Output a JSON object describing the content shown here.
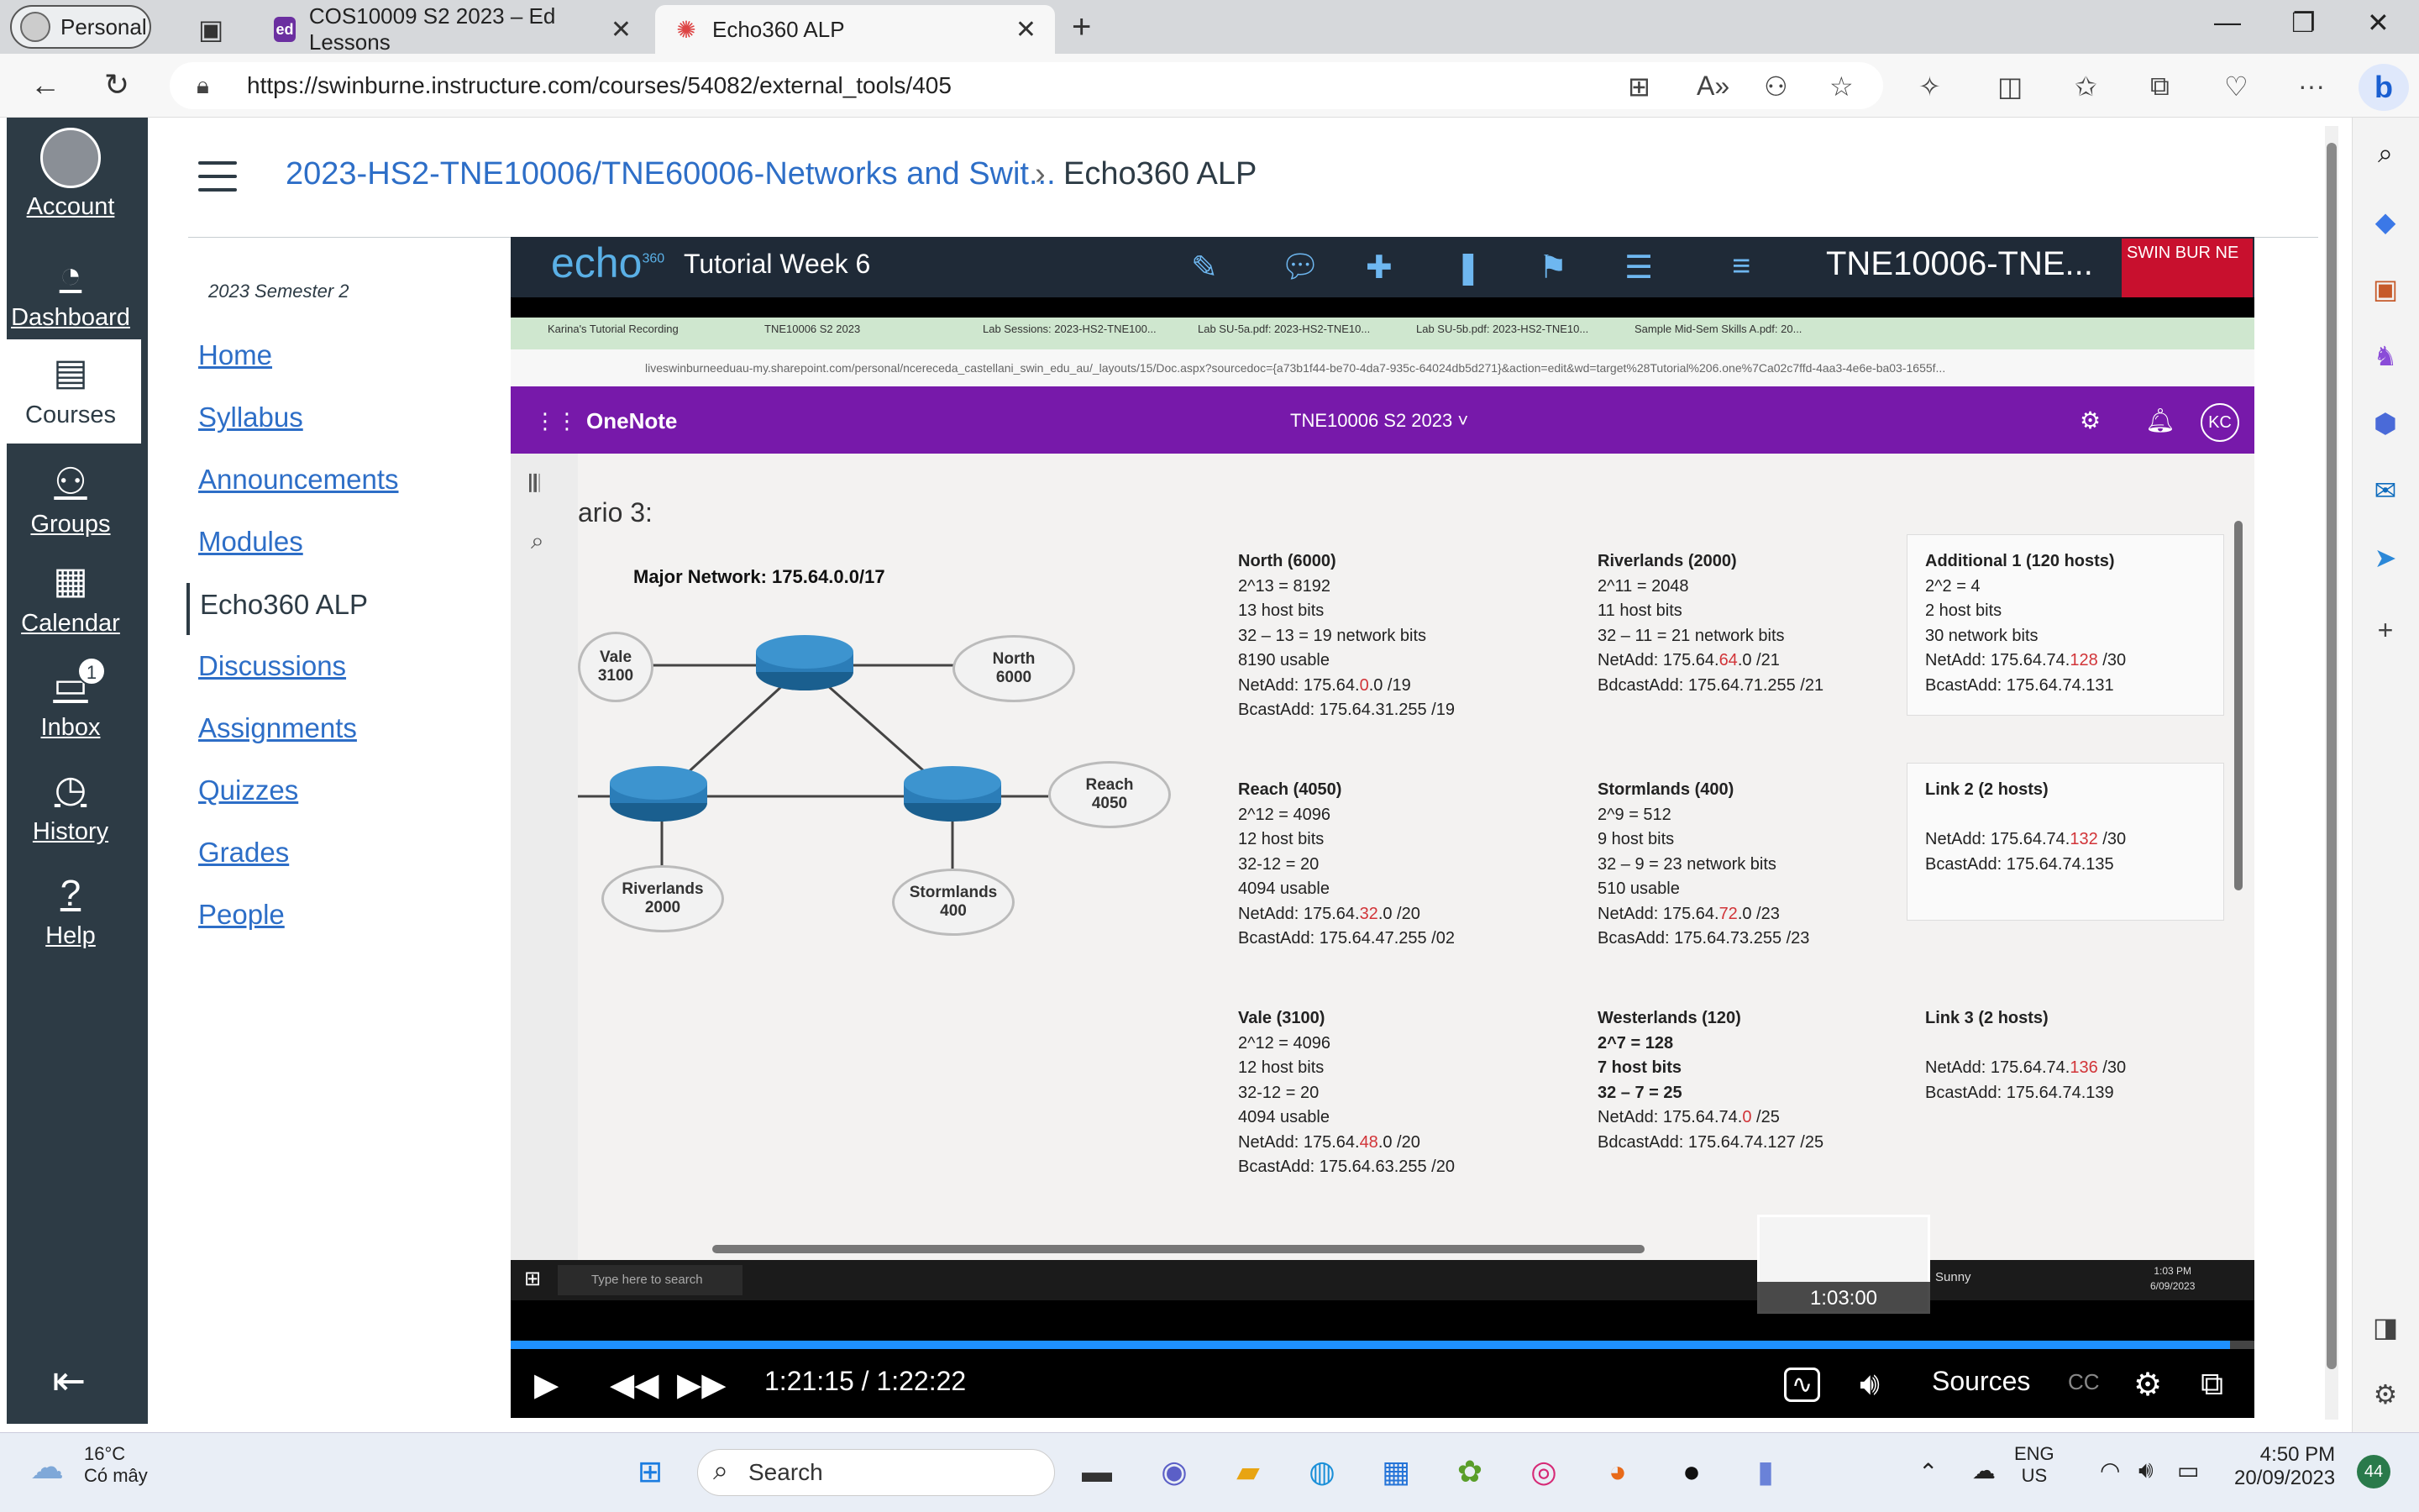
{
  "browser": {
    "profile": "Personal",
    "tabs": [
      {
        "title": "COS10009 S2 2023 – Ed Lessons",
        "favicon": "ed"
      },
      {
        "title": "Echo360 ALP",
        "favicon": "echo-icon"
      }
    ],
    "url": "https://swinburne.instructure.com/courses/54082/external_tools/405"
  },
  "global_nav": {
    "items": [
      {
        "label": "Account",
        "icon": "avatar"
      },
      {
        "label": "Dashboard",
        "icon": "dashboard-icon"
      },
      {
        "label": "Courses",
        "icon": "courses-icon"
      },
      {
        "label": "Groups",
        "icon": "groups-icon"
      },
      {
        "label": "Calendar",
        "icon": "calendar-icon"
      },
      {
        "label": "Inbox",
        "icon": "inbox-icon",
        "badge": "1"
      },
      {
        "label": "History",
        "icon": "history-icon"
      },
      {
        "label": "Help",
        "icon": "help-icon"
      }
    ]
  },
  "breadcrumb": {
    "course": "2023-HS2-TNE10006/TNE60006-Networks and Swit...",
    "page": "Echo360 ALP"
  },
  "course_nav": {
    "semester": "2023 Semester 2",
    "items": [
      "Home",
      "Syllabus",
      "Announcements",
      "Modules",
      "Echo360 ALP",
      "Discussions",
      "Assignments",
      "Quizzes",
      "Grades",
      "People"
    ]
  },
  "echo": {
    "logo": "echo",
    "logo_sup": "360",
    "title": "Tutorial Week 6",
    "course": "TNE10006-TNE...",
    "brand": "SWIN BUR NE",
    "time": "1:21:15 / 1:22:22",
    "progress": 0.986,
    "thumb_time": "1:03:00",
    "sources": "Sources",
    "cc": "CC"
  },
  "video": {
    "tabs": [
      "Karina's Tutorial Recording",
      "TNE10006 S2 2023",
      "Lab Sessions: 2023-HS2-TNE100...",
      "Lab SU-5a.pdf: 2023-HS2-TNE10...",
      "Lab SU-5b.pdf: 2023-HS2-TNE10...",
      "Sample Mid-Sem Skills A.pdf: 20..."
    ],
    "address": "liveswinburneeduau-my.sharepoint.com/personal/ncereceda_castellani_swin_edu_au/_layouts/15/Doc.aspx?sourcedoc={a73b1f44-be70-4da7-935c-64024db5d271}&action=edit&wd=target%28Tutorial%206.one%7Ca02c7ffd-4aa3-4e6e-ba03-1655f...",
    "app": "OneNote",
    "notebook": "TNE10006 S2 2023 ˅",
    "avatar": "KC",
    "scenario": "ario 3:",
    "major_network": "Major Network: 175.64.0.0/17",
    "clouds": [
      {
        "name": "Vale",
        "num": "3100"
      },
      {
        "name": "North",
        "num": "6000"
      },
      {
        "name": "Reach",
        "num": "4050"
      },
      {
        "name": "Riverlands",
        "num": "2000"
      },
      {
        "name": "Stormlands",
        "num": "400"
      }
    ],
    "blocks": [
      {
        "title": "North (6000)",
        "lines": [
          "2^13 = 8192",
          "13 host bits",
          "32 – 13 = 19 network bits",
          "8190 usable"
        ],
        "net_pre": "NetAdd: 175.64.",
        "net_red": "0",
        "net_post": ".0 /19",
        "bcast": "BcastAdd: 175.64.31.255 /19"
      },
      {
        "title": "Riverlands (2000)",
        "lines": [
          "2^11 = 2048",
          "11 host bits",
          "32 – 11 = 21 network bits"
        ],
        "net_pre": "NetAdd: 175.64.",
        "net_red": "64",
        "net_post": ".0 /21",
        "bcast": "BdcastAdd: 175.64.71.255 /21"
      },
      {
        "title": "Additional 1 (120 hosts)",
        "lines": [
          "2^2 = 4",
          "2 host bits",
          "30 network bits"
        ],
        "net_pre": "NetAdd: 175.64.74.",
        "net_red": "128",
        "net_post": " /30",
        "bcast": "BcastAdd: 175.64.74.131"
      },
      {
        "title": "Reach (4050)",
        "lines": [
          "2^12 = 4096",
          "12 host bits",
          "32-12 = 20",
          "4094 usable"
        ],
        "net_pre": "NetAdd: 175.64.",
        "net_red": "32",
        "net_post": ".0 /20",
        "bcast": "BcastAdd: 175.64.47.255 /02"
      },
      {
        "title": "Stormlands (400)",
        "lines": [
          "2^9 = 512",
          "9 host bits",
          "32 – 9 = 23 network bits",
          "510 usable"
        ],
        "net_pre": "NetAdd: 175.64.",
        "net_red": "72",
        "net_post": ".0 /23",
        "bcast": "BcasAdd: 175.64.73.255 /23"
      },
      {
        "title": "Link 2 (2 hosts)",
        "lines": [
          ""
        ],
        "net_pre": "NetAdd: 175.64.74.",
        "net_red": "132",
        "net_post": " /30",
        "bcast": "BcastAdd: 175.64.74.135"
      },
      {
        "title": "Vale (3100)",
        "lines": [
          "2^12 = 4096",
          "12 host bits",
          "32-12 = 20",
          "4094 usable"
        ],
        "net_pre": "NetAdd: 175.64.",
        "net_red": "48",
        "net_post": ".0 /20",
        "bcast": "BcastAdd: 175.64.63.255 /20"
      },
      {
        "title": "Westerlands (120)",
        "lines": [
          "2^7 = 128",
          "7 host bits",
          "32 – 7 = 25"
        ],
        "net_pre": "NetAdd: 175.64.74.",
        "net_red": "0",
        "net_post": " /25",
        "bcast": "BdcastAdd: 175.64.74.127 /25"
      },
      {
        "title": "Link 3 (2 hosts)",
        "lines": [
          ""
        ],
        "net_pre": "NetAdd: 175.64.74.",
        "net_red": "136",
        "net_post": " /30",
        "bcast": "BcastAdd: 175.64.74.139"
      }
    ],
    "taskbar_search": "Type here to search",
    "taskbar_weather": "Sunny",
    "taskbar_time": "1:03 PM",
    "taskbar_date": "6/09/2023"
  },
  "taskbar": {
    "temp": "16°C",
    "weather": "Có mây",
    "search": "Search",
    "lang1": "ENG",
    "lang2": "US",
    "time": "4:50 PM",
    "date": "20/09/2023",
    "notifications": "44"
  },
  "colors": {
    "canvas_nav": "#2d3b45",
    "link": "#2d6ec7",
    "onenote": "#7719aa",
    "echo_header": "#1f2a37",
    "swinburne_red": "#c8102e"
  }
}
